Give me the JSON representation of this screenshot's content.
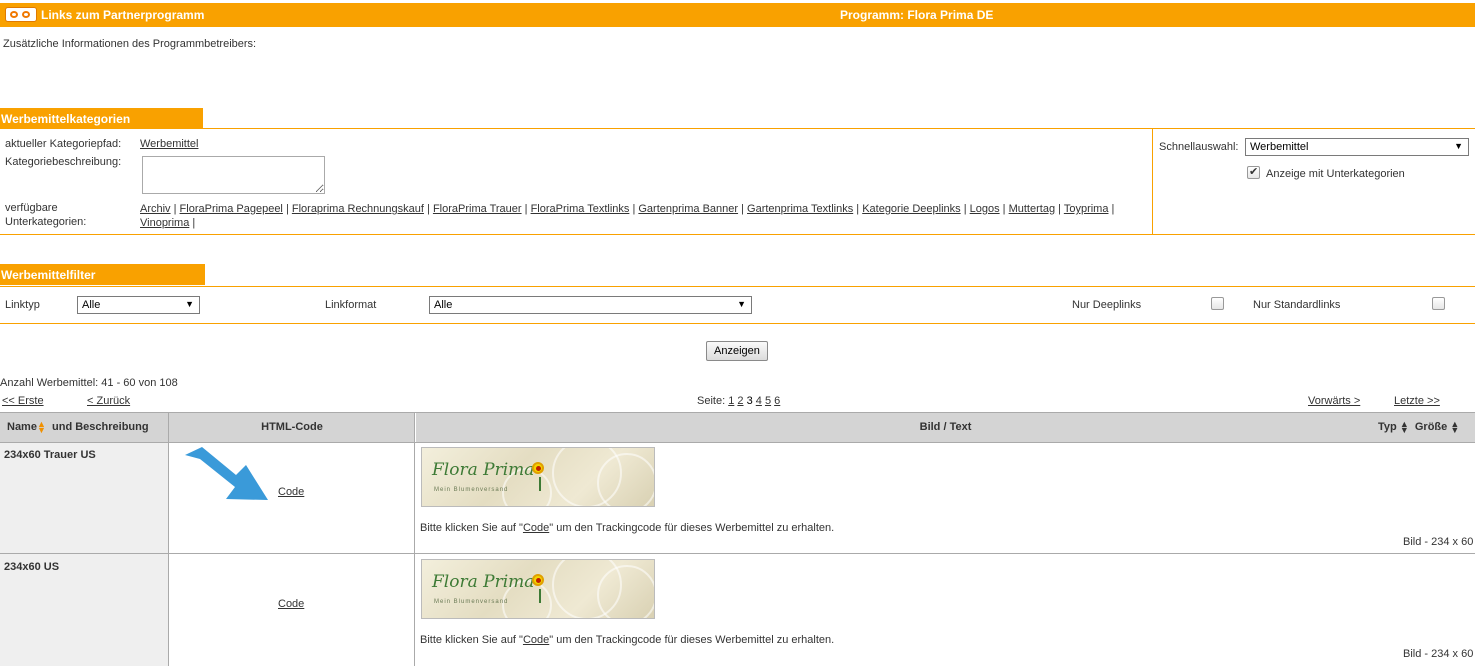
{
  "header": {
    "title": "Links zum Partnerprogramm",
    "program": "Programm: Flora Prima DE"
  },
  "info_text": "Zusätzliche Informationen des Programmbetreibers:",
  "categories": {
    "tab": "Werbemittelkategorien",
    "path_label": "aktueller Kategoriepfad:",
    "path_value": "Werbemittel",
    "desc_label": "Kategoriebeschreibung:",
    "sub_label_1": "verfügbare",
    "sub_label_2": "Unterkategorien:",
    "subcats": [
      "Archiv",
      "FloraPrima Pagepeel",
      "Floraprima Rechnungskauf",
      "FloraPrima Trauer",
      "FloraPrima Textlinks",
      "Gartenprima Banner",
      "Gartenprima Textlinks",
      "Kategorie Deeplinks",
      "Logos",
      "Muttertag",
      "Toyprima",
      "Vinoprima"
    ],
    "quick_label": "Schnellauswahl:",
    "quick_value": "Werbemittel",
    "show_sub_label": "Anzeige mit Unterkategorien",
    "show_sub_checked": true
  },
  "filter": {
    "tab": "Werbemittelfilter",
    "linktyp_label": "Linktyp",
    "linktyp_value": "Alle",
    "linkformat_label": "Linkformat",
    "linkformat_value": "Alle",
    "deeplinks_label": "Nur Deeplinks",
    "standard_label": "Nur Standardlinks",
    "show_button": "Anzeigen"
  },
  "pagination": {
    "count_text": "Anzahl Werbemittel: 41 - 60 von 108",
    "first": "<< Erste",
    "prev": "< Zurück",
    "page_label": "Seite:",
    "pages": [
      "1",
      "2",
      "3",
      "4",
      "5",
      "6"
    ],
    "current": "3",
    "next": "Vorwärts >",
    "last": "Letzte >>"
  },
  "table": {
    "col_name": "Name",
    "col_name_rest": "und Beschreibung",
    "col_html": "HTML-Code",
    "col_image": "Bild / Text",
    "col_type": "Typ",
    "col_size": "Größe",
    "rows": [
      {
        "name": "234x60 Trauer US",
        "code": "Code",
        "desc_prefix": "Bitte klicken Sie auf \"",
        "desc_link": "Code",
        "desc_suffix": "\" um den Trackingcode für dieses Werbemittel zu erhalten.",
        "meta": "Bild - 234 x 60",
        "banner_text": "Flora Prima",
        "banner_sub": "Mein Blumenversand"
      },
      {
        "name": "234x60 US",
        "code": "Code",
        "desc_prefix": "Bitte klicken Sie auf \"",
        "desc_link": "Code",
        "desc_suffix": "\" um den Trackingcode für dieses Werbemittel zu erhalten.",
        "meta": "Bild - 234 x 60",
        "banner_text": "Flora Prima",
        "banner_sub": "Mein Blumenversand"
      }
    ]
  },
  "colors": {
    "accent": "#f9a100",
    "arrow": "#3a9ad9"
  }
}
